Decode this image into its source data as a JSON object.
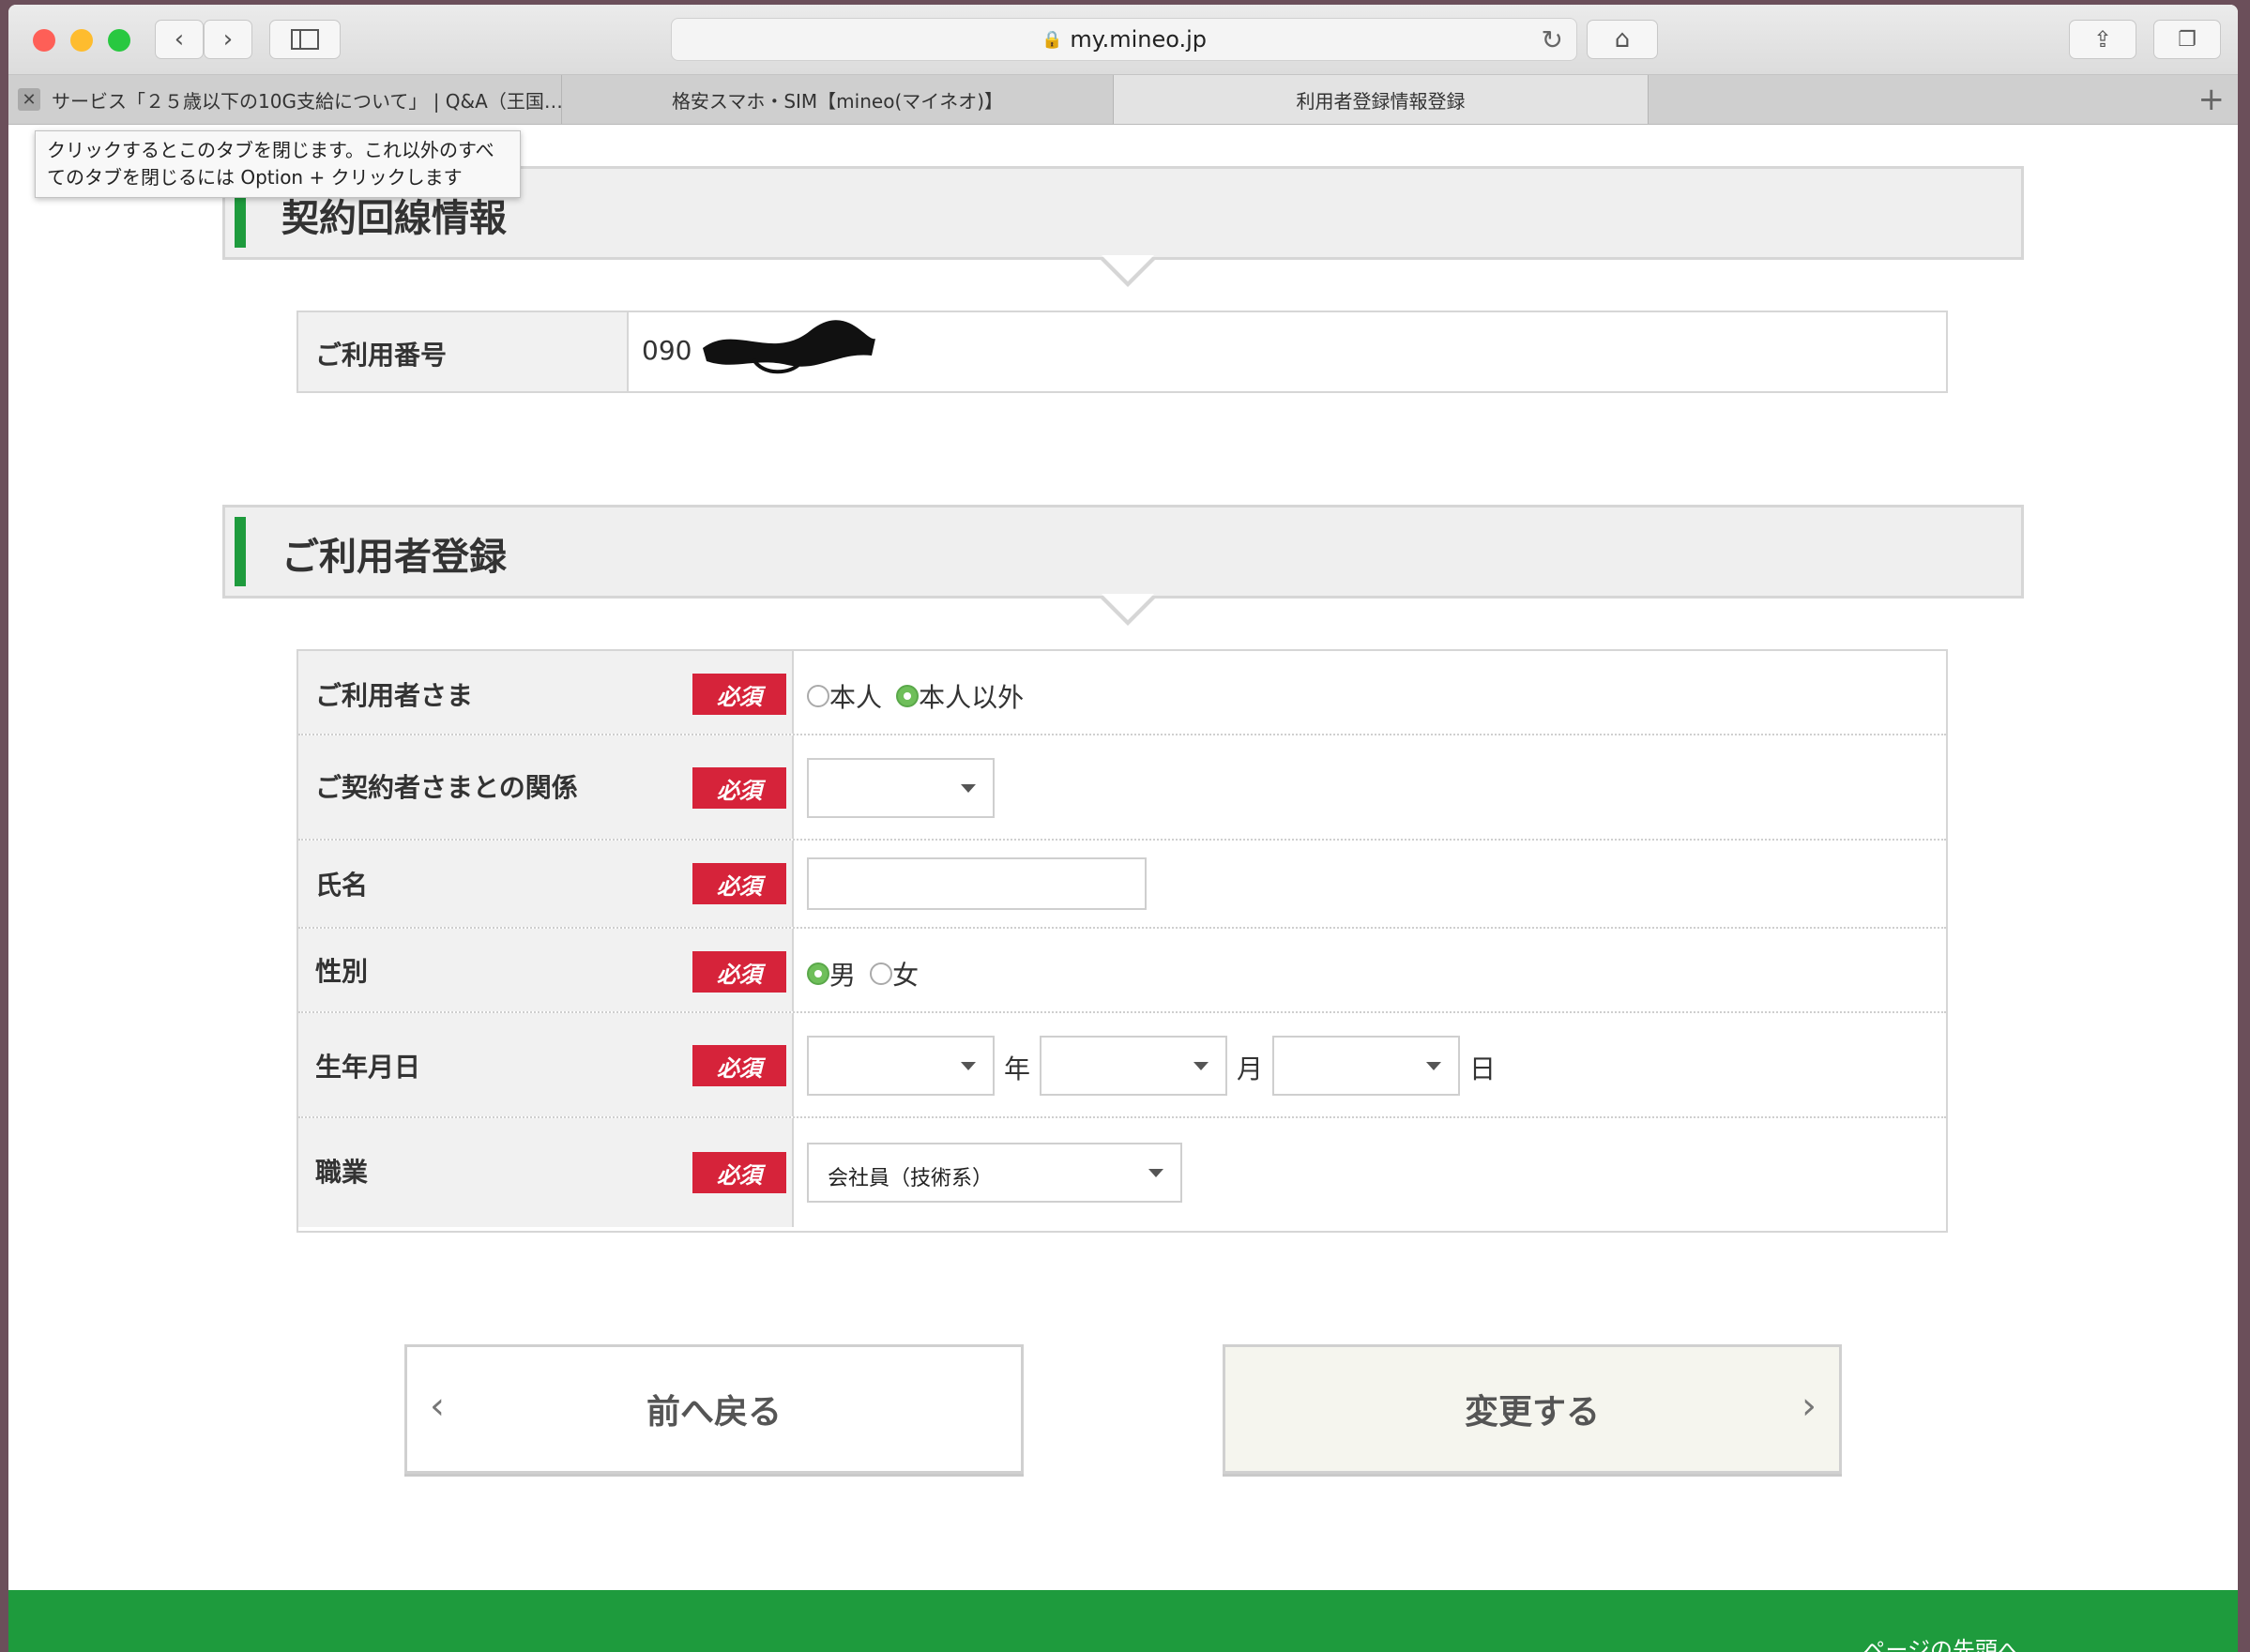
{
  "browser": {
    "url": "my.mineo.jp",
    "tabs": [
      {
        "label": "サービス「２５歳以下の10G支給について」 | Q&A（王国…"
      },
      {
        "label": "格安スマホ・SIM【mineo(マイネオ)】"
      },
      {
        "label": "利用者登録情報登録"
      }
    ],
    "tooltip": "クリックするとこのタブを閉じます。これ以外のすべてのタブを閉じるには Option + クリックします"
  },
  "contract": {
    "title": "契約回線情報",
    "number_label": "ご利用番号",
    "number_value": "090"
  },
  "registration": {
    "title": "ご利用者登録",
    "required_label": "必須",
    "rows": [
      {
        "label": "ご利用者さま",
        "options": [
          "本人",
          "本人以外"
        ],
        "selected": "本人以外"
      },
      {
        "label": "ご契約者さまとの関係",
        "value": ""
      },
      {
        "label": "氏名",
        "value": ""
      },
      {
        "label": "性別",
        "options": [
          "男",
          "女"
        ],
        "selected": "男"
      },
      {
        "label": "生年月日",
        "units": [
          "年",
          "月",
          "日"
        ]
      },
      {
        "label": "職業",
        "value": "会社員（技術系）"
      }
    ]
  },
  "buttons": {
    "back": "前へ戻る",
    "submit": "変更する"
  },
  "footer": {
    "to_top": "ページの先頭へ"
  },
  "colors": {
    "accent_green": "#1e9b3d",
    "required_red": "#d6233a"
  }
}
